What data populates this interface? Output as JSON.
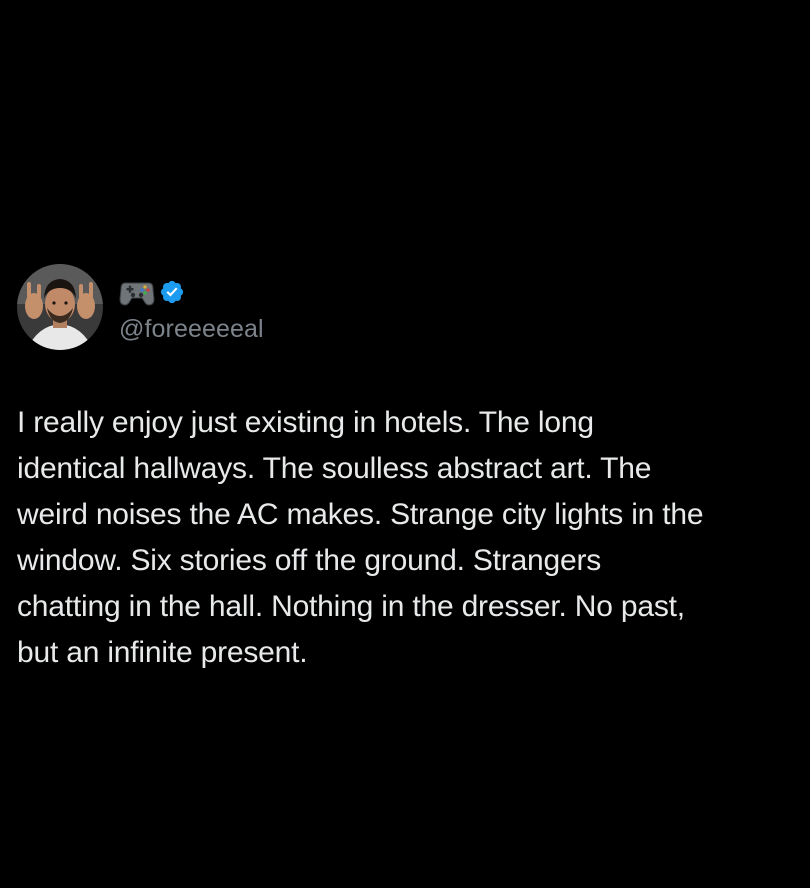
{
  "tweet": {
    "handle": "@foreeeeeal",
    "display_name_emoji_icon": "gamepad-icon",
    "verified_icon": "verified-badge-icon",
    "colors": {
      "background": "#000000",
      "text": "#e7e9ea",
      "handle": "#7c838a",
      "verified": "#1d9bf0"
    },
    "text": "I really enjoy just existing in hotels. The long\nidentical hallways. The soulless abstract art. The\nweird noises the AC makes. Strange city lights in the\nwindow. Six stories off the ground. Strangers\nchatting in the hall. Nothing in the dresser. No past,\nbut an infinite present."
  }
}
